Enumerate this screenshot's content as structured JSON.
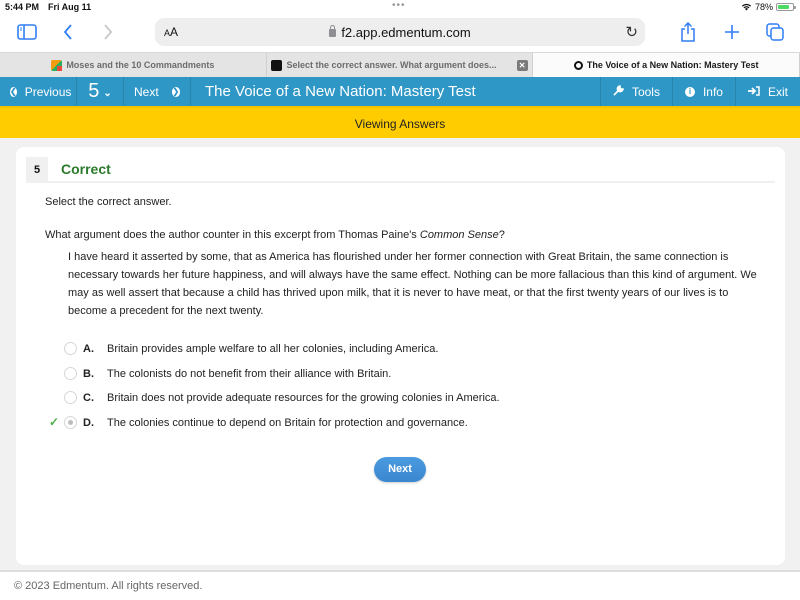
{
  "status_bar": {
    "time": "5:44 PM",
    "date": "Fri Aug 11",
    "battery": "78%",
    "battery_level": 0.78
  },
  "browser": {
    "text_size_label": "AA",
    "url": "f2.app.edmentum.com",
    "tabs": [
      {
        "label": "Moses and the 10 Commandments",
        "active": false
      },
      {
        "label": "Select the correct answer. What argument does...",
        "active": false
      },
      {
        "label": "The Voice of a New Nation: Mastery Test",
        "active": true
      }
    ]
  },
  "nav": {
    "previous_label": "Previous",
    "question_number": "5",
    "next_label": "Next",
    "title": "The Voice of a New Nation: Mastery Test",
    "tools_label": "Tools",
    "info_label": "Info",
    "exit_label": "Exit"
  },
  "banner": {
    "text": "Viewing Answers"
  },
  "question": {
    "number": "5",
    "status": "Correct",
    "instruction": "Select the correct answer.",
    "prompt_before": "What argument does the author counter in this excerpt from Thomas Paine's ",
    "prompt_italic": "Common Sense",
    "prompt_after": "?",
    "excerpt": "I have heard it asserted by some, that as America has flourished under her former connection with Great Britain, the same connection is necessary towards her future happiness, and will always have the same effect. Nothing can be more fallacious than this kind of argument. We may as well assert that because a child has thrived upon milk, that it is never to have meat, or that the first twenty years of our lives is to become a precedent for the next twenty.",
    "options": [
      {
        "letter": "A.",
        "text": "Britain provides ample welfare to all her colonies, including America.",
        "selected": false,
        "correct": false
      },
      {
        "letter": "B.",
        "text": "The colonists do not benefit from their alliance with Britain.",
        "selected": false,
        "correct": false
      },
      {
        "letter": "C.",
        "text": "Britain does not provide adequate resources for the growing colonies in America.",
        "selected": false,
        "correct": false
      },
      {
        "letter": "D.",
        "text": "The colonies continue to depend on Britain for protection and governance.",
        "selected": true,
        "correct": true
      }
    ],
    "next_button": "Next"
  },
  "footer": {
    "copyright": "© 2023 Edmentum. All rights reserved."
  },
  "colors": {
    "nav_blue": "#2f97c6",
    "banner_yellow": "#ffcc00",
    "correct_green": "#2d7a2d",
    "button_blue": "#3b86cf"
  }
}
